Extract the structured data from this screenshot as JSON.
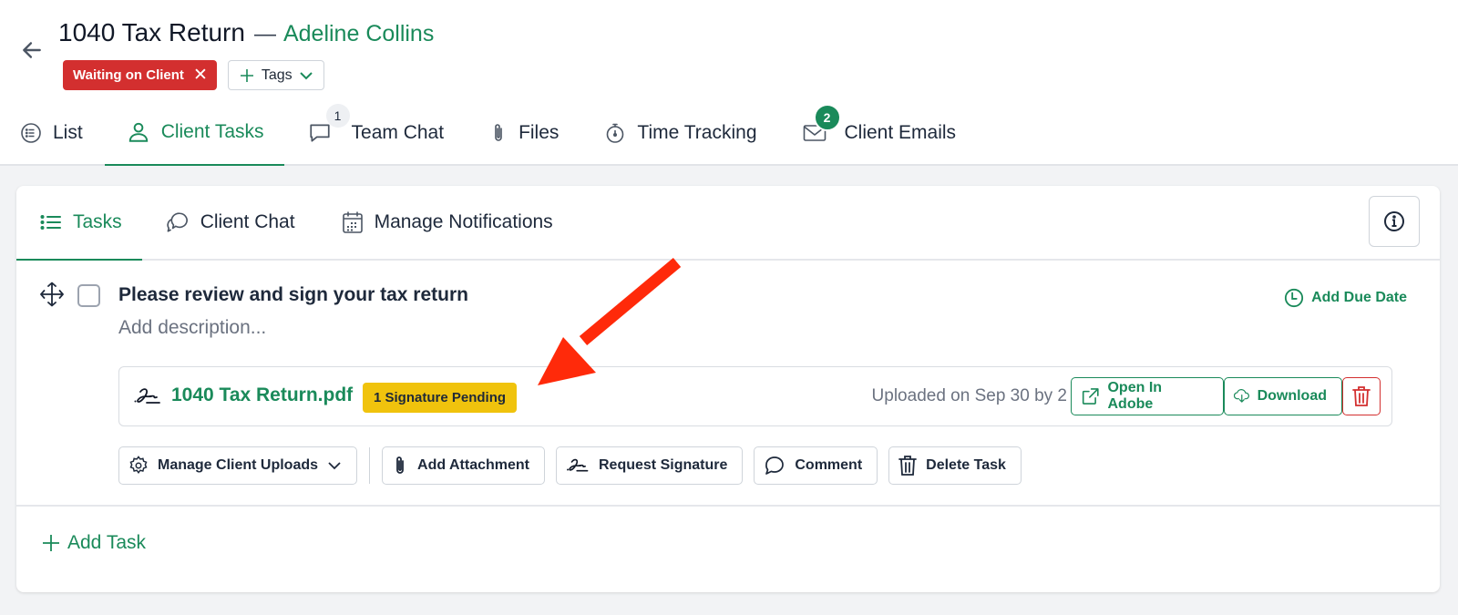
{
  "header": {
    "title": "1040 Tax Return",
    "separator": "—",
    "client_name": "Adeline Collins",
    "status_tag": "Waiting on Client",
    "status_tag_close": "✕",
    "tags_button": "Tags"
  },
  "main_tabs": [
    {
      "label": "List",
      "icon": "list-icon",
      "active": false
    },
    {
      "label": "Client Tasks",
      "icon": "user-icon",
      "active": true
    },
    {
      "label": "Team Chat",
      "icon": "chat-icon",
      "badge": "1",
      "active": false
    },
    {
      "label": "Files",
      "icon": "paperclip-icon",
      "active": false
    },
    {
      "label": "Time Tracking",
      "icon": "stopwatch-icon",
      "active": false
    },
    {
      "label": "Client Emails",
      "icon": "mail-icon",
      "badge": "2",
      "active": false
    }
  ],
  "sub_tabs": [
    {
      "label": "Tasks",
      "icon": "list-icon",
      "active": true
    },
    {
      "label": "Client Chat",
      "icon": "chat-bubbles-icon",
      "active": false
    },
    {
      "label": "Manage Notifications",
      "icon": "calendar-icon",
      "active": false
    }
  ],
  "task": {
    "title": "Please review and sign your tax return",
    "description_placeholder": "Add description...",
    "due_date_label": "Add Due Date",
    "completed": false,
    "file": {
      "name": "1040 Tax Return.pdf",
      "signature_badge": "1 Signature Pending",
      "uploaded_text": "Uploaded on Sep 30 by 2",
      "open_label": "Open In Adobe",
      "download_label": "Download"
    },
    "actions": {
      "manage_uploads": "Manage Client Uploads",
      "add_attachment": "Add Attachment",
      "request_signature": "Request Signature",
      "comment": "Comment",
      "delete_task": "Delete Task"
    }
  },
  "add_task_label": "Add Task",
  "colors": {
    "brand_green": "#1a8a5a",
    "status_red": "#d32f2f",
    "signature_yellow": "#f0c30d",
    "annotation_arrow": "#ff2a0a"
  }
}
